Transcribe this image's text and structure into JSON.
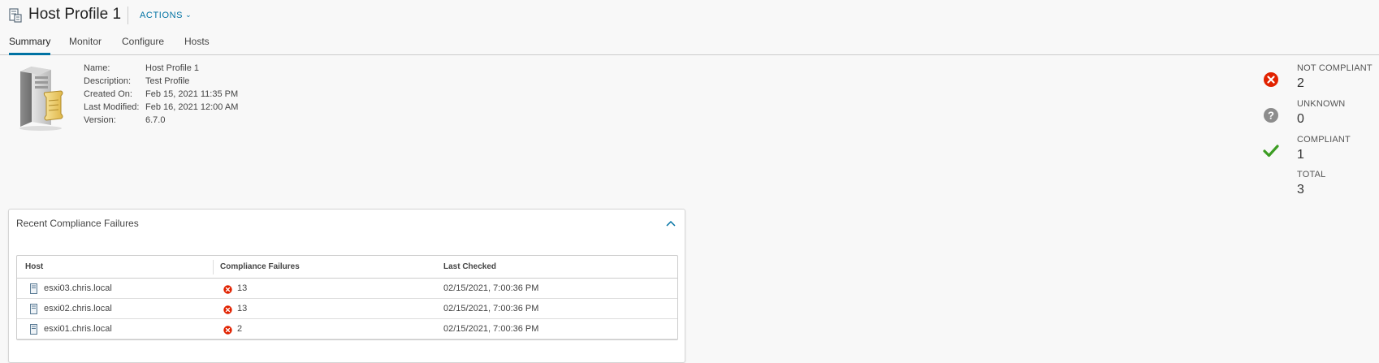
{
  "header": {
    "title": "Host Profile 1",
    "actions_label": "ACTIONS",
    "title_icon": "host-profile-icon"
  },
  "tabs": [
    {
      "label": "Summary",
      "active": true
    },
    {
      "label": "Monitor",
      "active": false
    },
    {
      "label": "Configure",
      "active": false
    },
    {
      "label": "Hosts",
      "active": false
    }
  ],
  "summary": {
    "icon": "server-profile-icon",
    "fields": [
      {
        "label": "Name:",
        "value": "Host Profile 1"
      },
      {
        "label": "Description:",
        "value": "Test Profile"
      },
      {
        "label": "Created On:",
        "value": "Feb 15, 2021 11:35 PM"
      },
      {
        "label": "Last Modified:",
        "value": "Feb 16, 2021 12:00 AM"
      },
      {
        "label": "Version:",
        "value": "6.7.0"
      }
    ]
  },
  "compliance": {
    "items": [
      {
        "label": "NOT COMPLIANT",
        "value": "2",
        "icon": "error-circle-icon",
        "color": "#e12200"
      },
      {
        "label": "UNKNOWN",
        "value": "0",
        "icon": "question-circle-icon",
        "color": "#8c8c8c"
      },
      {
        "label": "COMPLIANT",
        "value": "1",
        "icon": "check-icon",
        "color": "#3c9d23"
      },
      {
        "label": "TOTAL",
        "value": "3",
        "icon": "",
        "color": ""
      }
    ]
  },
  "failures_card": {
    "title": "Recent Compliance Failures",
    "columns": [
      "Host",
      "Compliance Failures",
      "Last Checked"
    ],
    "rows": [
      {
        "host": "esxi03.chris.local",
        "failures": "13",
        "last_checked": "02/15/2021, 7:00:36 PM"
      },
      {
        "host": "esxi02.chris.local",
        "failures": "13",
        "last_checked": "02/15/2021, 7:00:36 PM"
      },
      {
        "host": "esxi01.chris.local",
        "failures": "2",
        "last_checked": "02/15/2021, 7:00:36 PM"
      }
    ]
  },
  "colors": {
    "accent": "#0072a3",
    "error": "#e12200",
    "success": "#3c9d23"
  }
}
